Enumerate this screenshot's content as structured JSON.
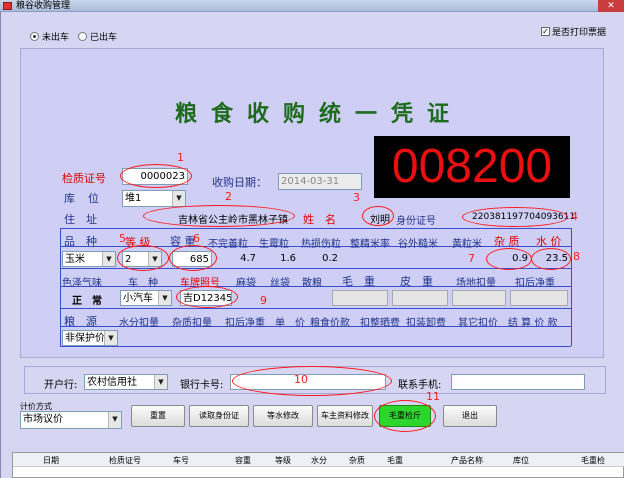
{
  "window": {
    "title": "粮谷收购管理",
    "close_glyph": "✕"
  },
  "status_radios": {
    "out_label": "未出车",
    "in_label": "已出车",
    "selected": "未出车"
  },
  "print_ticket": {
    "label": "是否打印票据",
    "checked": true,
    "mark": "✓"
  },
  "document_title": "粮食收购统一凭证",
  "ticket_number": "008200",
  "form": {
    "inspection_no_label": "检质证号",
    "inspection_no": "0000023",
    "warehouse_label": "库　位",
    "warehouse": "堆1",
    "date_label": "收购日期：",
    "date": "2014-03-31",
    "address_label": "住　址",
    "address": "吉林省公主岭市黑林子镇",
    "name_label": "姓　名",
    "name": "刘明",
    "id_label": "身份证号",
    "id_number": "220381197704093611",
    "variety_label": "品　种",
    "variety": "玉米",
    "grade_label": "等 级",
    "grade": "2",
    "density_label": "容 重",
    "density": "685",
    "imperfect_label": "不完善粒",
    "imperfect": "4.7",
    "sprouted_label": "生霉粒",
    "sprouted": "1.6",
    "heat_damaged_label": "热损伤粒",
    "heat_damaged": "0.2",
    "polished_rate_label": "整精米率",
    "valley_rice_label": "谷外糙米",
    "yellow_rice_label": "黄粒米",
    "impurity_label": "杂 质",
    "impurity": "0.9",
    "moisture_label": "水 价",
    "moisture": "23.5",
    "color_smell_label": "色泽气味",
    "color_smell": "正　常",
    "vehicle_type_label": "车　种",
    "vehicle_type": "小汽车",
    "plate_label": "车牌照号",
    "plate": "吉D12345",
    "sack_label": "麻袋",
    "bag_label": "丝袋",
    "bulk_label": "散粮",
    "bulk_checked": "✓",
    "gross_weight_label": "毛　重",
    "tare_weight_label": "皮　重",
    "yard_deduct_label": "场地扣量",
    "net_weight_label": "扣后净重",
    "source_label": "粮　源",
    "source": "非保护价",
    "moisture_deduct_label": "水分扣量",
    "impurity_deduct_label": "杂质扣量",
    "after_net_label": "扣后净重",
    "unit_price_label": "单　价",
    "grain_payment_label": "粮食价款",
    "drying_fee_label": "扣整晒费",
    "loading_fee_label": "扣装卸费",
    "other_deduct_label": "其它扣价",
    "settlement_label": "结 算 价 款"
  },
  "bank": {
    "bank_label": "开户行:",
    "bank": "农村信用社",
    "card_label": "银行卡号:",
    "card": "",
    "phone_label": "联系手机:",
    "phone": ""
  },
  "pricing": {
    "label": "计价方式",
    "value": "市场议价"
  },
  "buttons": {
    "reset": "重置",
    "read_id": "读取身份证",
    "water_adjust": "等水修改",
    "owner_edit": "车主资料修改",
    "gross_weigh": "毛重检斤",
    "exit": "退出"
  },
  "table_columns": [
    "日期",
    "检质证号",
    "车号",
    "容重",
    "等级",
    "水分",
    "杂质",
    "毛重",
    "产品名称",
    "库位",
    "毛重检"
  ],
  "annotations": [
    "1",
    "2",
    "3",
    "4",
    "5",
    "6",
    "7",
    "8",
    "9",
    "10",
    "11"
  ],
  "colors": {
    "annotation": "#ff1a1a",
    "label_red": "#e00000",
    "label_blue": "#22338a",
    "title_green": "#1d6b1d",
    "counter_red": "#e81010",
    "button_green": "#2dd62d"
  }
}
